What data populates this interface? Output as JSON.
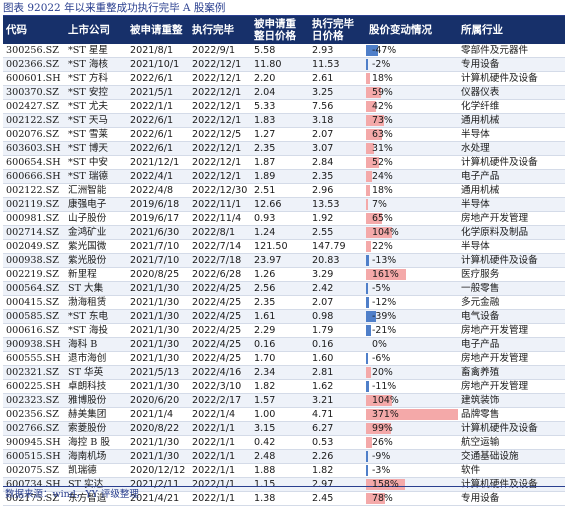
{
  "caption": "图表 92022 年以来重整成功执行完毕 A 股案例",
  "headers": [
    "代码",
    "上市公司",
    "被申请重整",
    "执行完毕",
    "被申请重整日价格",
    "执行完毕日价格",
    "股价变动情况",
    "所属行业"
  ],
  "rows": [
    {
      "code": "300256.SZ",
      "name": "*ST 星星",
      "apply": "2021/8/1",
      "done": "2022/9/1",
      "p1": "5.58",
      "p2": "2.93",
      "pct": "-47%",
      "chg": -47,
      "ind": "零部件及元器件"
    },
    {
      "code": "002366.SZ",
      "name": "*ST 海核",
      "apply": "2021/10/1",
      "done": "2022/12/1",
      "p1": "11.80",
      "p2": "11.53",
      "pct": "-2%",
      "chg": -2,
      "ind": "专用设备"
    },
    {
      "code": "600601.SH",
      "name": "*ST 方科",
      "apply": "2022/6/1",
      "done": "2022/12/1",
      "p1": "2.20",
      "p2": "2.61",
      "pct": "18%",
      "chg": 18,
      "ind": "计算机硬件及设备"
    },
    {
      "code": "300370.SZ",
      "name": "*ST 安控",
      "apply": "2021/5/1",
      "done": "2022/12/1",
      "p1": "2.04",
      "p2": "3.25",
      "pct": "59%",
      "chg": 59,
      "ind": "仪器仪表"
    },
    {
      "code": "002427.SZ",
      "name": "*ST 尤夫",
      "apply": "2022/1/1",
      "done": "2022/12/1",
      "p1": "5.33",
      "p2": "7.56",
      "pct": "42%",
      "chg": 42,
      "ind": "化学纤维"
    },
    {
      "code": "002122.SZ",
      "name": "*ST 天马",
      "apply": "2022/6/1",
      "done": "2022/12/1",
      "p1": "1.83",
      "p2": "3.18",
      "pct": "73%",
      "chg": 73,
      "ind": "通用机械"
    },
    {
      "code": "002076.SZ",
      "name": "*ST 雪莱",
      "apply": "2022/6/1",
      "done": "2022/12/5",
      "p1": "1.27",
      "p2": "2.07",
      "pct": "63%",
      "chg": 63,
      "ind": "半导体"
    },
    {
      "code": "603603.SH",
      "name": "*ST 博天",
      "apply": "2022/6/1",
      "done": "2022/12/1",
      "p1": "2.35",
      "p2": "3.07",
      "pct": "31%",
      "chg": 31,
      "ind": "水处理"
    },
    {
      "code": "600654.SH",
      "name": "*ST 中安",
      "apply": "2021/12/1",
      "done": "2022/12/1",
      "p1": "1.87",
      "p2": "2.84",
      "pct": "52%",
      "chg": 52,
      "ind": "计算机硬件及设备"
    },
    {
      "code": "600666.SH",
      "name": "*ST 瑞德",
      "apply": "2022/4/1",
      "done": "2022/12/1",
      "p1": "1.89",
      "p2": "2.35",
      "pct": "24%",
      "chg": 24,
      "ind": "电子产品"
    },
    {
      "code": "002122.SZ",
      "name": "汇洲智能",
      "apply": "2022/4/8",
      "done": "2022/12/30",
      "p1": "2.51",
      "p2": "2.96",
      "pct": "18%",
      "chg": 18,
      "ind": "通用机械"
    },
    {
      "code": "002119.SZ",
      "name": "康强电子",
      "apply": "2019/6/18",
      "done": "2022/11/1",
      "p1": "12.66",
      "p2": "13.53",
      "pct": "7%",
      "chg": 7,
      "ind": "半导体"
    },
    {
      "code": "000981.SZ",
      "name": "山子股份",
      "apply": "2019/6/17",
      "done": "2022/11/4",
      "p1": "0.93",
      "p2": "1.92",
      "pct": "65%",
      "chg": 65,
      "ind": "房地产开发管理"
    },
    {
      "code": "002714.SZ",
      "name": "金鸿矿业",
      "apply": "2021/6/30",
      "done": "2022/8/1",
      "p1": "1.24",
      "p2": "2.55",
      "pct": "104%",
      "chg": 104,
      "ind": "化学原料及制品"
    },
    {
      "code": "002049.SZ",
      "name": "紫光国微",
      "apply": "2021/7/10",
      "done": "2022/7/14",
      "p1": "121.50",
      "p2": "147.79",
      "pct": "22%",
      "chg": 22,
      "ind": "半导体"
    },
    {
      "code": "000938.SZ",
      "name": "紫光股份",
      "apply": "2021/7/10",
      "done": "2022/7/18",
      "p1": "23.97",
      "p2": "20.83",
      "pct": "-13%",
      "chg": -13,
      "ind": "计算机硬件及设备"
    },
    {
      "code": "002219.SZ",
      "name": "新里程",
      "apply": "2020/8/25",
      "done": "2022/6/28",
      "p1": "1.26",
      "p2": "3.29",
      "pct": "161%",
      "chg": 161,
      "ind": "医疗服务"
    },
    {
      "code": "000564.SZ",
      "name": "ST 大集",
      "apply": "2021/1/30",
      "done": "2022/4/25",
      "p1": "2.56",
      "p2": "2.42",
      "pct": "-5%",
      "chg": -5,
      "ind": "一般零售"
    },
    {
      "code": "000415.SZ",
      "name": "渤海租赁",
      "apply": "2021/1/30",
      "done": "2022/4/25",
      "p1": "2.35",
      "p2": "2.07",
      "pct": "-12%",
      "chg": -12,
      "ind": "多元金融"
    },
    {
      "code": "000585.SZ",
      "name": "*ST 东电",
      "apply": "2021/1/30",
      "done": "2022/4/25",
      "p1": "1.61",
      "p2": "0.98",
      "pct": "-39%",
      "chg": -39,
      "ind": "电气设备"
    },
    {
      "code": "000616.SZ",
      "name": "*ST 海投",
      "apply": "2021/1/30",
      "done": "2022/4/25",
      "p1": "2.29",
      "p2": "1.79",
      "pct": "-21%",
      "chg": -21,
      "ind": "房地产开发管理"
    },
    {
      "code": "900938.SH",
      "name": "海科 B",
      "apply": "2021/1/30",
      "done": "2022/4/25",
      "p1": "0.16",
      "p2": "0.16",
      "pct": "0%",
      "chg": 0,
      "ind": "电子产品"
    },
    {
      "code": "600555.SH",
      "name": "退市海创",
      "apply": "2021/1/30",
      "done": "2022/4/25",
      "p1": "1.70",
      "p2": "1.60",
      "pct": "-6%",
      "chg": -6,
      "ind": "房地产开发管理"
    },
    {
      "code": "002321.SZ",
      "name": "ST 华英",
      "apply": "2021/5/13",
      "done": "2022/4/16",
      "p1": "2.34",
      "p2": "2.81",
      "pct": "20%",
      "chg": 20,
      "ind": "畜禽养殖"
    },
    {
      "code": "600225.SH",
      "name": "卓朗科技",
      "apply": "2021/1/30",
      "done": "2022/3/10",
      "p1": "1.82",
      "p2": "1.62",
      "pct": "-11%",
      "chg": -11,
      "ind": "房地产开发管理"
    },
    {
      "code": "002323.SZ",
      "name": "雅博股份",
      "apply": "2020/6/20",
      "done": "2022/2/17",
      "p1": "1.57",
      "p2": "3.21",
      "pct": "104%",
      "chg": 104,
      "ind": "建筑装饰"
    },
    {
      "code": "002356.SZ",
      "name": "赫美集团",
      "apply": "2021/1/4",
      "done": "2022/1/4",
      "p1": "1.00",
      "p2": "4.71",
      "pct": "371%",
      "chg": 371,
      "ind": "品牌零售"
    },
    {
      "code": "002766.SZ",
      "name": "索菱股份",
      "apply": "2020/8/22",
      "done": "2022/1/1",
      "p1": "3.15",
      "p2": "6.27",
      "pct": "99%",
      "chg": 99,
      "ind": "计算机硬件及设备"
    },
    {
      "code": "900945.SH",
      "name": "海控 B 股",
      "apply": "2021/1/30",
      "done": "2022/1/1",
      "p1": "0.42",
      "p2": "0.53",
      "pct": "26%",
      "chg": 26,
      "ind": "航空运输"
    },
    {
      "code": "600515.SH",
      "name": "海南机场",
      "apply": "2021/1/30",
      "done": "2022/1/1",
      "p1": "2.48",
      "p2": "2.26",
      "pct": "-9%",
      "chg": -9,
      "ind": "交通基础设施"
    },
    {
      "code": "002075.SZ",
      "name": "凯瑞德",
      "apply": "2020/12/12",
      "done": "2022/1/1",
      "p1": "1.88",
      "p2": "1.82",
      "pct": "-3%",
      "chg": -3,
      "ind": "软件"
    },
    {
      "code": "600734.SH",
      "name": "ST 实达",
      "apply": "2021/2/11",
      "done": "2022/1/1",
      "p1": "1.15",
      "p2": "2.97",
      "pct": "158%",
      "chg": 158,
      "ind": "计算机硬件及设备"
    },
    {
      "code": "002175.SZ",
      "name": "东方智造",
      "apply": "2021/4/21",
      "done": "2022/1/1",
      "p1": "1.38",
      "p2": "2.45",
      "pct": "78%",
      "chg": 78,
      "ind": "专用设备"
    }
  ],
  "source": "数据来源：wind，YY 评级整理",
  "colors": {
    "header_bg": "#17306a",
    "negative_bar": "#4f7fc9",
    "positive_bar": "#f4a9a9"
  }
}
